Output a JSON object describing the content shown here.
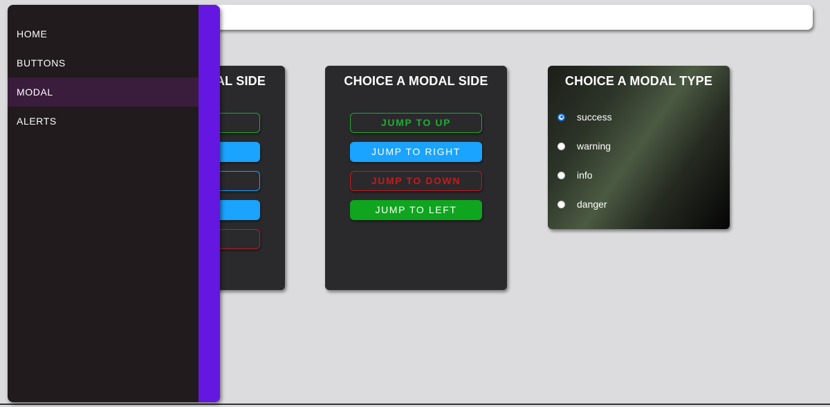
{
  "sidebar": {
    "items": [
      {
        "label": "HOME",
        "active": false
      },
      {
        "label": "BUTTONS",
        "active": false
      },
      {
        "label": "MODAL",
        "active": true
      },
      {
        "label": "ALERTS",
        "active": false
      }
    ],
    "accent_color": "#6417e0"
  },
  "cards": {
    "side_card_partial": {
      "title": "CHOICE A MODAL SIDE"
    },
    "side_card": {
      "title": "CHOICE A MODAL SIDE",
      "buttons": [
        {
          "label": "JUMP TO UP",
          "style": "outline-green"
        },
        {
          "label": "JUMP TO RIGHT",
          "style": "fill-blue"
        },
        {
          "label": "JUMP TO DOWN",
          "style": "outline-red"
        },
        {
          "label": "JUMP TO LEFT",
          "style": "fill-green"
        }
      ]
    },
    "type_card": {
      "title": "CHOICE A MODAL TYPE",
      "options": [
        {
          "label": "success",
          "checked": true
        },
        {
          "label": "warning",
          "checked": false
        },
        {
          "label": "info",
          "checked": false
        },
        {
          "label": "danger",
          "checked": false
        }
      ]
    }
  },
  "colors": {
    "background": "#dcdcdf",
    "card": "#2a2a2d",
    "green": "#1fae2e",
    "blue": "#1aa3ff",
    "red": "#c91a1a",
    "sidebar": "#211b1d"
  }
}
